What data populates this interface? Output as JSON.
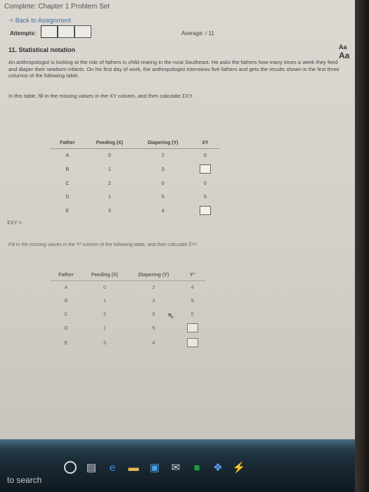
{
  "header": {
    "title": "Complete: Chapter 1 Problem Set",
    "back_link": "< Back to Assignment"
  },
  "attempts": {
    "label": "Attempts:",
    "average_label": "Average: / 11"
  },
  "question": {
    "number_title": "11. Statistical notation",
    "text_size_label": "Aa",
    "paragraph": "An anthropologist is looking at the role of fathers in child rearing in the rural Southeast. He asks the fathers how many times a week they feed and diaper their newborn infants. On his first day of work, the anthropologist interviews five fathers and gets the results shown in the first three columns of the following table.",
    "instruction": "In this table, fill in the missing values in the XY column, and then calculate ΣXY.",
    "sum_label": "ΣXY ="
  },
  "table1": {
    "headers": [
      "Father",
      "Feeding (X)",
      "Diapering (Y)",
      "XY"
    ],
    "rows": [
      {
        "father": "A",
        "x": "0",
        "y": "2",
        "xy": "0"
      },
      {
        "father": "B",
        "x": "1",
        "y": "3",
        "xy": ""
      },
      {
        "father": "C",
        "x": "2",
        "y": "0",
        "xy": "0"
      },
      {
        "father": "D",
        "x": "1",
        "y": "5",
        "xy": "5"
      },
      {
        "father": "E",
        "x": "3",
        "y": "4",
        "xy": ""
      }
    ]
  },
  "part2": {
    "instruction": "Fill in the missing values in the Y² column of the following table, and then calculate ΣY².",
    "headers": [
      "Father",
      "Feeding (X)",
      "Diapering (Y)",
      "Y²"
    ],
    "rows": [
      {
        "father": "A",
        "x": "0",
        "y": "2",
        "y2": "4"
      },
      {
        "father": "B",
        "x": "1",
        "y": "3",
        "y2": "9"
      },
      {
        "father": "C",
        "x": "2",
        "y": "0",
        "y2": "0"
      },
      {
        "father": "D",
        "x": "1",
        "y": "5",
        "y2": ""
      },
      {
        "father": "E",
        "x": "3",
        "y": "4",
        "y2": ""
      }
    ]
  },
  "taskbar": {
    "search_text": "to search"
  }
}
